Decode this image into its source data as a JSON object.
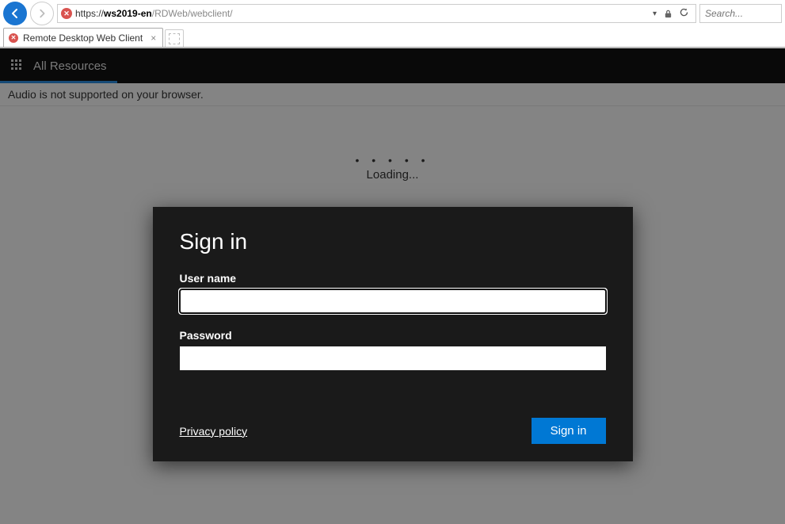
{
  "browser": {
    "url_protocol": "https://",
    "url_host": "ws2019-en",
    "url_path": "/RDWeb/webclient/",
    "search_placeholder": "Search...",
    "tab_title": "Remote Desktop Web Client"
  },
  "topbar": {
    "title": "All Resources"
  },
  "warning": {
    "text": "Audio is not supported on your browser."
  },
  "loading": {
    "label": "Loading..."
  },
  "dialog": {
    "heading": "Sign in",
    "username_label": "User name",
    "username_value": "",
    "password_label": "Password",
    "password_value": "",
    "privacy_label": "Privacy policy",
    "submit_label": "Sign in"
  }
}
